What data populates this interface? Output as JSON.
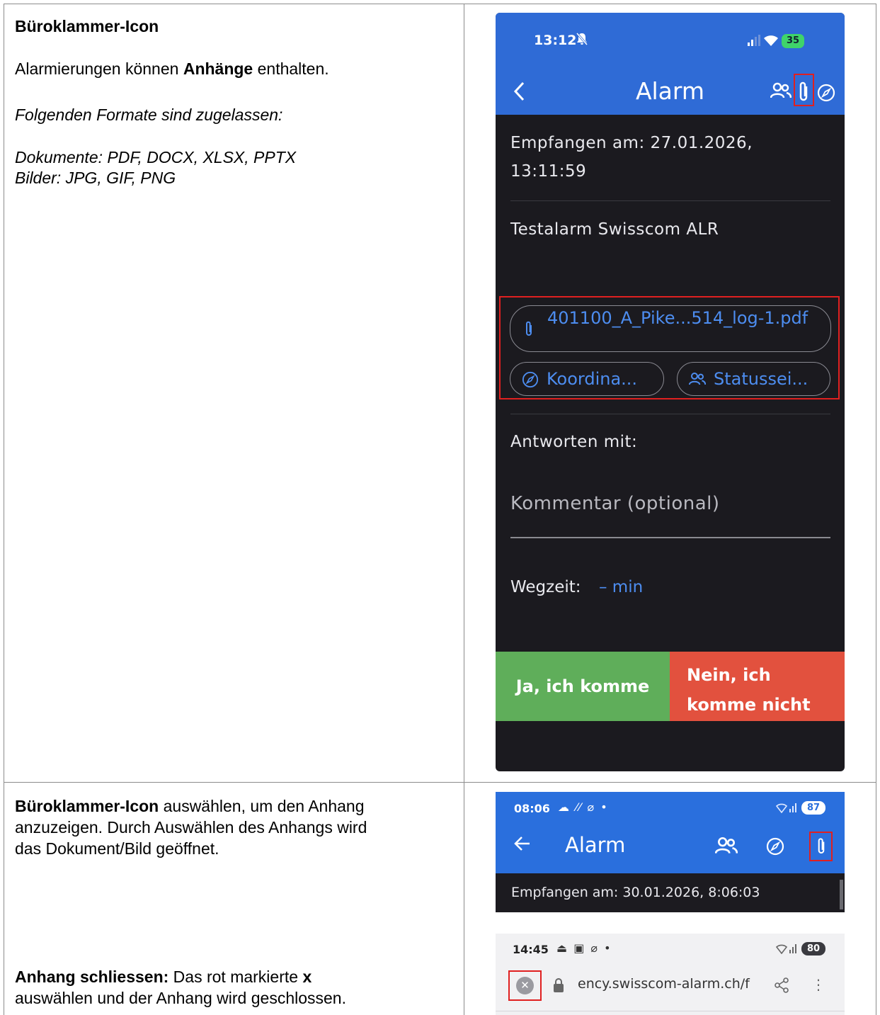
{
  "row1": {
    "heading": "Büroklammer-Icon",
    "intro_pre": "Alarmierungen können ",
    "intro_bold": "Anhänge",
    "intro_post": " enthalten.",
    "formats_title": "Folgenden Formate sind zugelassen:",
    "formats_docs": "Dokumente: PDF, DOCX, XLSX, PPTX",
    "formats_images": "Bilder: JPG, GIF, PNG"
  },
  "row2": {
    "select_bold": "Büroklammer-Icon",
    "select_line1_rest": " auswählen, um den Anhang",
    "select_line2": "anzuzeigen. Durch Auswählen des Anhangs wird",
    "select_line3": "das Dokument/Bild geöffnet.",
    "close_bold": "Anhang schliessen:",
    "close_line1_mid": " Das rot markierte ",
    "close_x": "x",
    "close_line2": "auswählen und der Anhang wird geschlossen."
  },
  "phone1": {
    "time": "13:12",
    "battery": "35",
    "title": "Alarm",
    "received_line1": "Empfangen am: 27.01.2026,",
    "received_line2": "13:11:59",
    "message": "Testalarm Swisscom ALR",
    "attachment": "401100_A_Pike...514_log-1.pdf",
    "coordinates": "Koordina...",
    "status": "Statussei...",
    "reply_label": "Antworten mit:",
    "comment_placeholder": "Kommentar (optional)",
    "travel_label": "Wegzeit:",
    "travel_value": "– min",
    "yes_button": "Ja, ich komme",
    "no_button_line1": "Nein, ich",
    "no_button_line2": "komme nicht",
    "colors": {
      "header": "#2f6bd6",
      "yes": "#5fae5a",
      "no": "#e2513e",
      "link": "#4d8df0",
      "highlight": "#e02020"
    }
  },
  "phone2": {
    "time": "08:06",
    "status_icons": "☁ ⁄⁄ ⌀ •",
    "battery": "87",
    "title": "Alarm",
    "received": "Empfangen am: 30.01.2026, 8:06:03"
  },
  "phone3": {
    "time": "14:45",
    "status_icons": "⏏ ▣ ⌀ •",
    "battery": "80",
    "url": "ency.swisscom-alarm.ch/f",
    "close_glyph": "✕",
    "more_glyph": "⋮"
  }
}
